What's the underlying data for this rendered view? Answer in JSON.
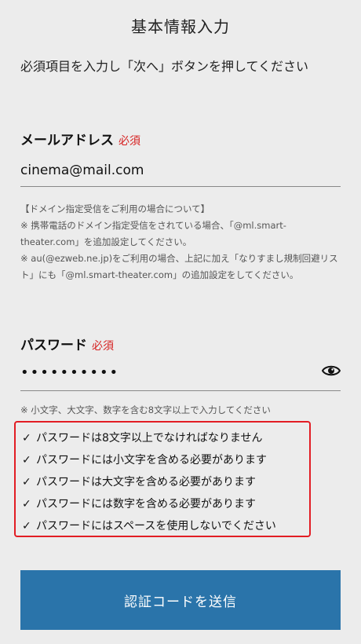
{
  "header": {
    "title": "基本情報入力"
  },
  "instructions": "必須項目を入力し「次へ」ボタンを押してください",
  "email": {
    "label": "メールアドレス",
    "required": "必須",
    "value": "cinema@mail.com"
  },
  "notice": {
    "heading": "【ドメイン指定受信をご利用の場合について】",
    "line1": "※ 携帯電話のドメイン指定受信をされている場合、「@ml.smart-theater.com」を追加設定してください。",
    "line2": "※ au(@ezweb.ne.jp)をご利用の場合、上記に加え「なりすまし規制回避リスト」にも「@ml.smart-theater.com」の追加設定をしてください。"
  },
  "password": {
    "label": "パスワード",
    "required": "必須",
    "value": "••••••••••",
    "toggle_icon": "eye-icon",
    "hint": "※ 小文字、大文字、数字を含む8文字以上で入力してください"
  },
  "rules": {
    "check_mark": "✓",
    "items": [
      "パスワードは8文字以上でなければなりません",
      "パスワードには小文字を含める必要があります",
      "パスワードは大文字を含める必要があります",
      "パスワードには数字を含める必要があります",
      "パスワードにはスペースを使用しないでください"
    ]
  },
  "submit": {
    "label": "認証コードを送信"
  },
  "colors": {
    "background": "#ececec",
    "required": "#d62020",
    "rules_border": "#e21d24",
    "button": "#2a74aa"
  }
}
